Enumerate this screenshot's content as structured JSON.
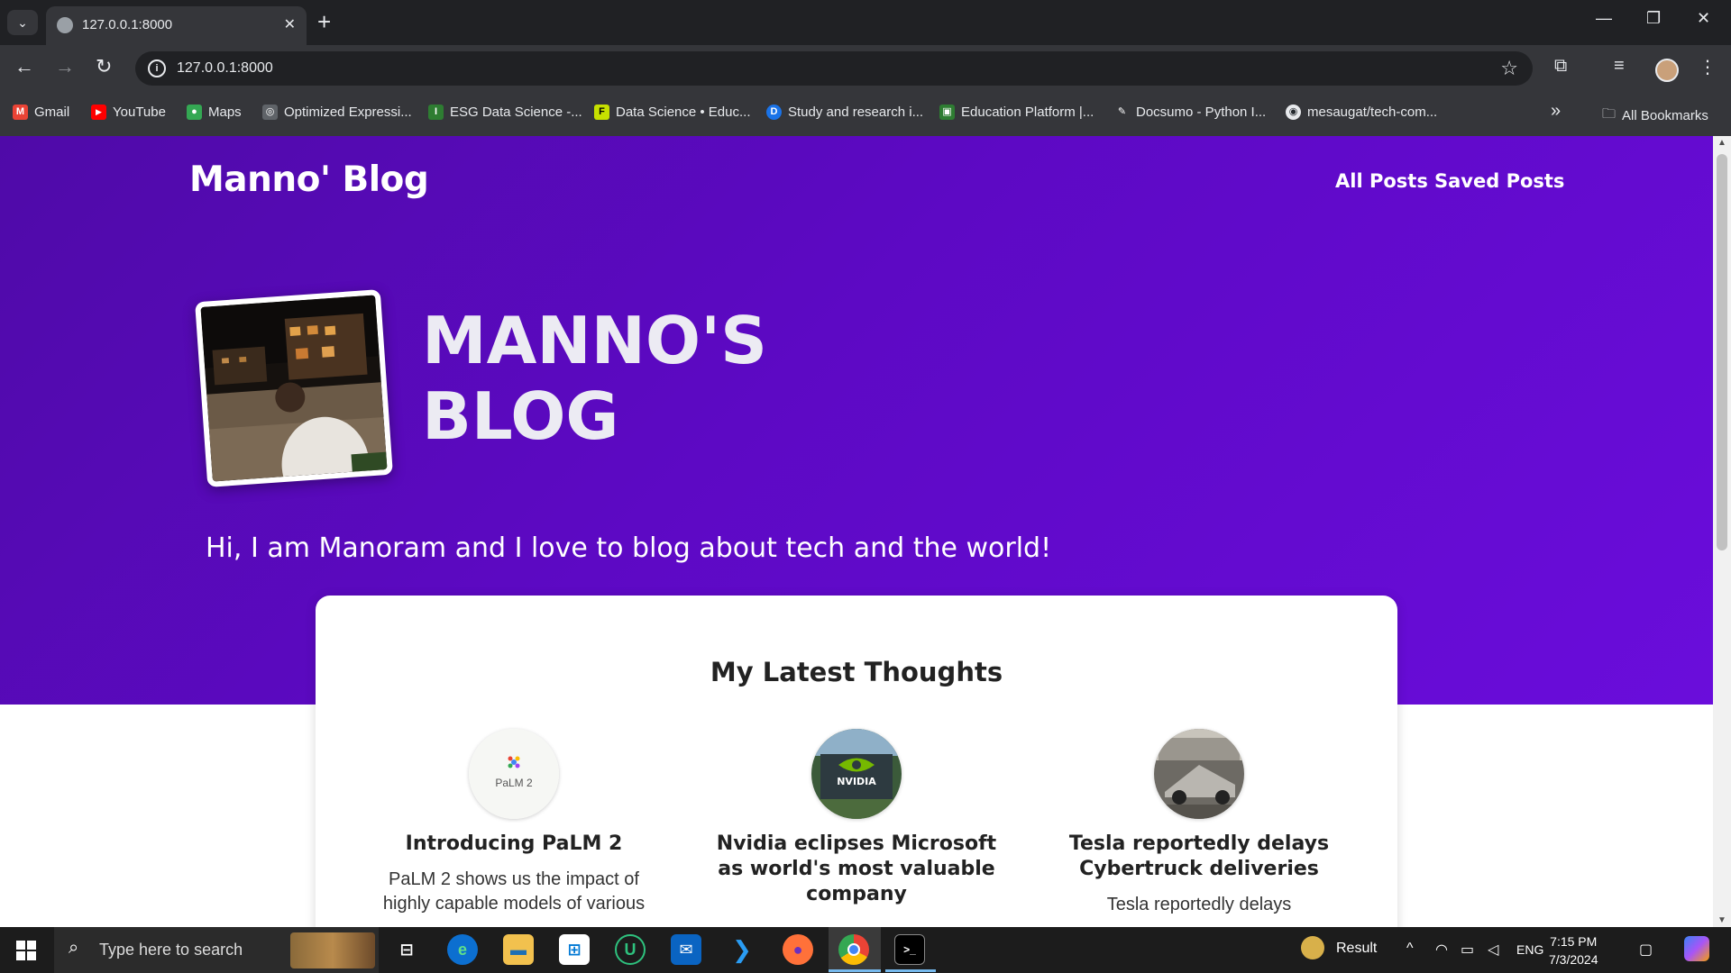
{
  "browser": {
    "tab_title": "127.0.0.1:8000",
    "tab_close": "✕",
    "new_tab": "+",
    "url": "127.0.0.1:8000",
    "info_icon": "i",
    "bookmarks": [
      {
        "label": "Gmail",
        "icon": "gmail-icon",
        "color": "#ea4335",
        "glyph": "M"
      },
      {
        "label": "YouTube",
        "icon": "youtube-icon",
        "color": "#ff0000",
        "glyph": "▶"
      },
      {
        "label": "Maps",
        "icon": "maps-icon",
        "color": "#34a853",
        "glyph": "●"
      },
      {
        "label": "Optimized Expressi...",
        "icon": "openai-icon",
        "color": "#5f6368",
        "glyph": "◎"
      },
      {
        "label": "ESG Data Science -...",
        "icon": "imu-icon",
        "color": "#2e7d32",
        "glyph": "I"
      },
      {
        "label": "Data Science • Educ...",
        "icon": "datascience-icon",
        "color": "#c6e000",
        "glyph": "F"
      },
      {
        "label": "Study and research i...",
        "icon": "d-icon",
        "color": "#1a73e8",
        "glyph": "D"
      },
      {
        "label": "Education Platform |...",
        "icon": "education-icon",
        "color": "#2e7d32",
        "glyph": "▣"
      },
      {
        "label": "Docsumo - Python I...",
        "icon": "pen-icon",
        "color": "#5f6368",
        "glyph": "✎"
      },
      {
        "label": "mesaugat/tech-com...",
        "icon": "github-icon",
        "color": "#24292e",
        "glyph": "◉"
      }
    ],
    "more_bookmarks": "»",
    "all_bookmarks": "All Bookmarks"
  },
  "site": {
    "brand": "Manno' Blog",
    "nav": [
      {
        "label": "All Posts"
      },
      {
        "label": "Saved Posts"
      }
    ],
    "hero_heading_line1": "MANNO'S",
    "hero_heading_line2": "BLOG",
    "tagline": "Hi, I am Manoram and I love to blog about tech and the world!"
  },
  "latest": {
    "heading": "My Latest Thoughts",
    "posts": [
      {
        "title": "Introducing PaLM 2",
        "excerpt": "PaLM 2 shows us the impact of highly capable models of various",
        "thumb_text": "PaLM 2"
      },
      {
        "title": "Nvidia eclipses Microsoft as world's most valuable company",
        "excerpt": "",
        "thumb_text": "NVIDIA"
      },
      {
        "title": "Tesla reportedly delays Cybertruck deliveries",
        "excerpt": "Tesla reportedly delays",
        "thumb_text": ""
      }
    ]
  },
  "taskbar": {
    "search_placeholder": "Type here to search",
    "weather_label": "Result",
    "language": "ENG",
    "time": "7:15 PM",
    "date": "7/3/2024"
  },
  "colors": {
    "hero_gradient_start": "#4f0aa8",
    "hero_gradient_end": "#6a0ddb",
    "chrome_dark": "#202124",
    "chrome_toolbar": "#35363a"
  }
}
